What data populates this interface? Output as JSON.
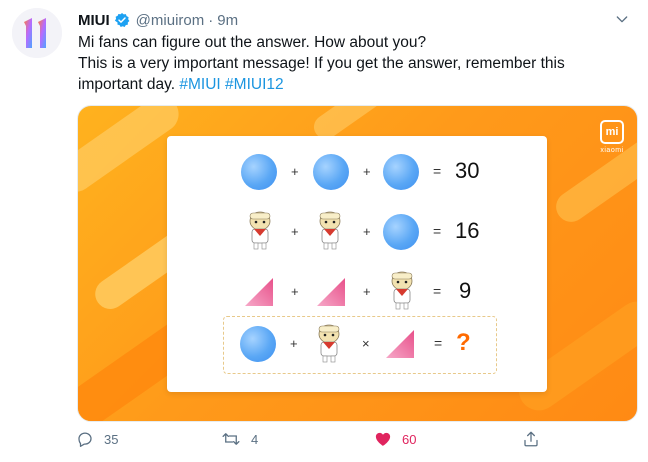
{
  "tweet": {
    "author_name": "MIUI",
    "handle": "@miuirom",
    "separator": "·",
    "time": "9m",
    "text_line1": "Mi fans can figure out the answer. How about you?",
    "text_line2": "This is a very important message! If you get the answer, remember this",
    "text_line3_prefix": "important day.",
    "hashtags": [
      "#MIUI",
      "#MIUI12"
    ]
  },
  "media": {
    "brand_logo_text": "mi",
    "brand_name": "xiaomi",
    "puzzle": {
      "rows": [
        {
          "terms": [
            "circle",
            "circle",
            "circle"
          ],
          "ops": [
            "+",
            "+"
          ],
          "equals": "=",
          "result": "30"
        },
        {
          "terms": [
            "doll",
            "doll",
            "circle"
          ],
          "ops": [
            "+",
            "+"
          ],
          "equals": "=",
          "result": "16"
        },
        {
          "terms": [
            "triangle",
            "triangle",
            "doll"
          ],
          "ops": [
            "+",
            "+"
          ],
          "equals": "=",
          "result": "9"
        },
        {
          "terms": [
            "circle",
            "doll",
            "triangle"
          ],
          "ops": [
            "+",
            "×"
          ],
          "equals": "=",
          "result": "?"
        }
      ]
    }
  },
  "actions": {
    "reply_count": "35",
    "retweet_count": "4",
    "like_count": "60",
    "liked": true,
    "like_color": "#e0245e",
    "icon_color": "#5b7083"
  },
  "colors": {
    "hashtag": "#1b95e0",
    "verified": "#1da1f2",
    "media_bg": "#ff9a1a",
    "question_mark": "#ff6a00"
  }
}
